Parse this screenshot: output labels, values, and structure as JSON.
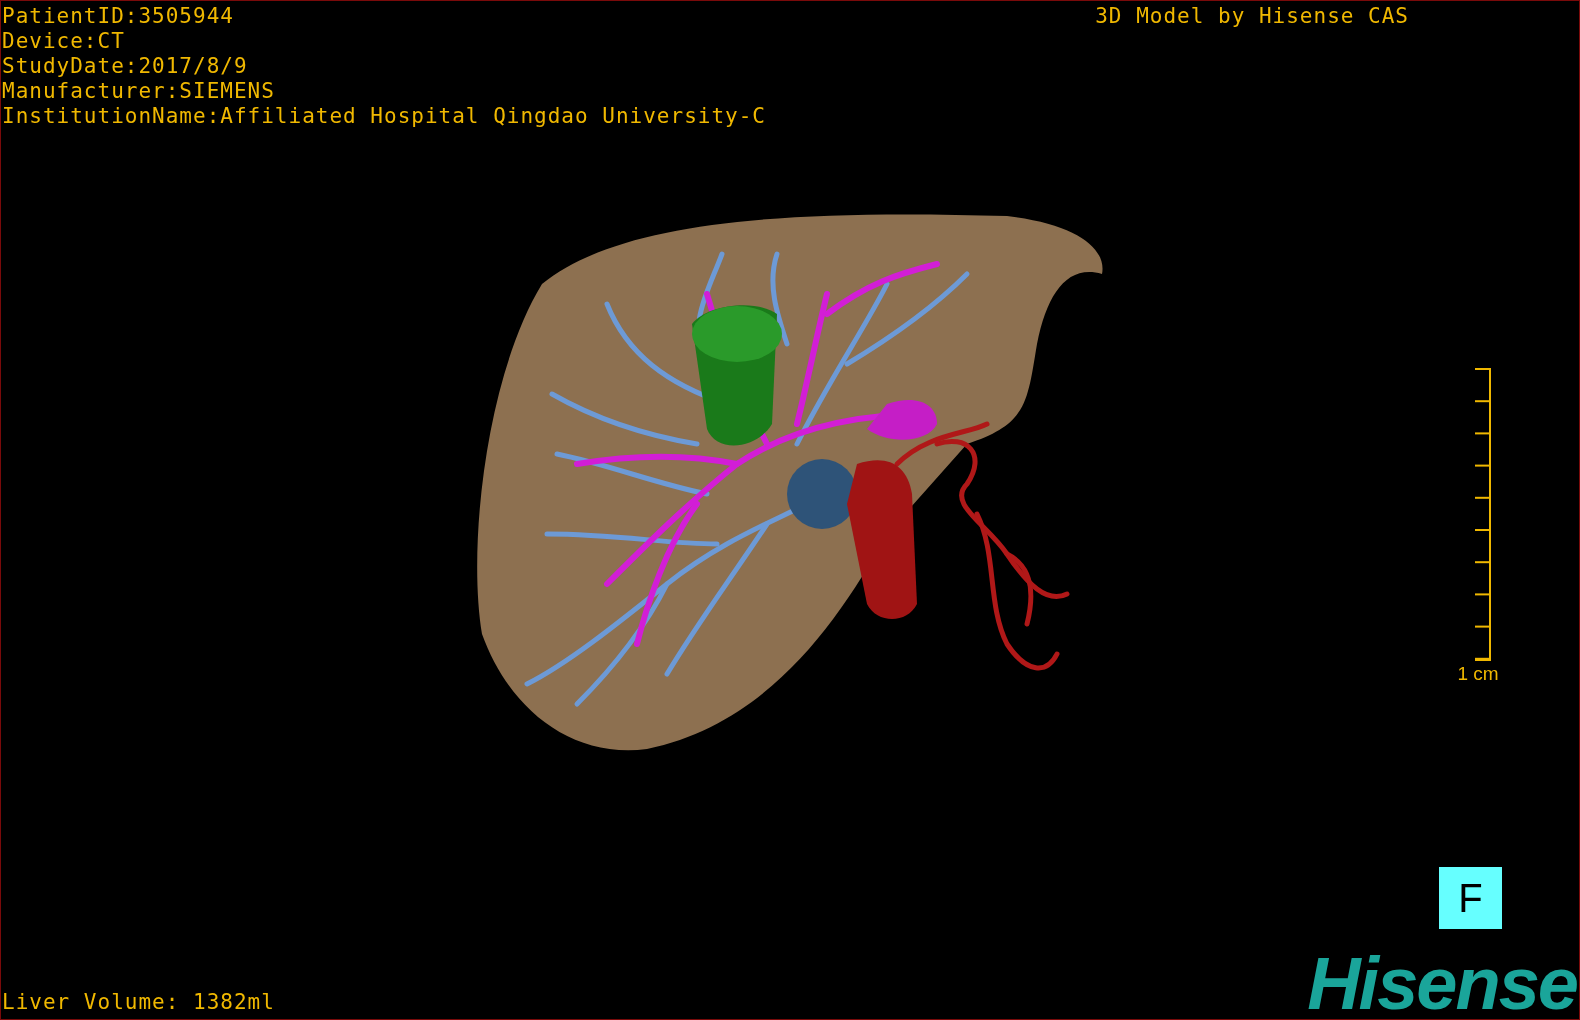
{
  "patient_info": [
    "PatientID:3505944",
    "Device:CT",
    "StudyDate:2017/8/9",
    "Manufacturer:SIEMENS",
    "InstitutionName:Affiliated Hospital Qingdao University-C"
  ],
  "model_credit": "3D Model by Hisense CAS",
  "scale_bar": {
    "label": "1 cm"
  },
  "view_orientation": "F",
  "liver_volume": "Liver Volume: 1382ml",
  "logo": "Hisense"
}
